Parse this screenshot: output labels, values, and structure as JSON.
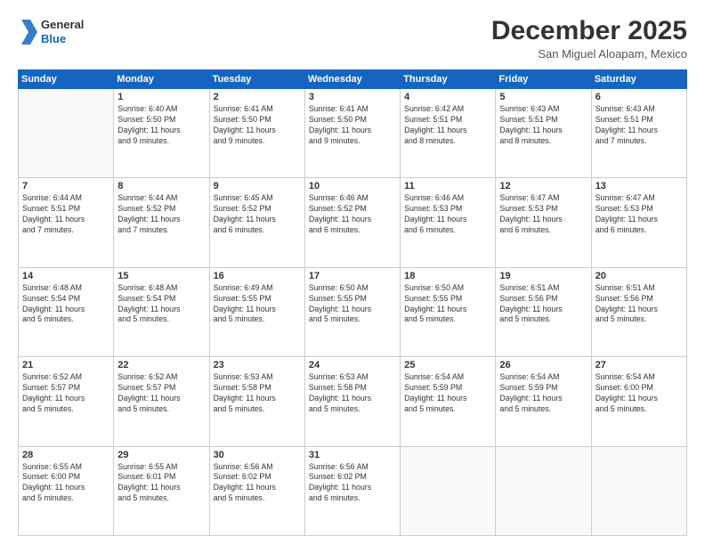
{
  "logo": {
    "line1": "General",
    "line2": "Blue"
  },
  "title": "December 2025",
  "subtitle": "San Miguel Aloapam, Mexico",
  "days_header": [
    "Sunday",
    "Monday",
    "Tuesday",
    "Wednesday",
    "Thursday",
    "Friday",
    "Saturday"
  ],
  "weeks": [
    [
      {
        "num": "",
        "info": ""
      },
      {
        "num": "1",
        "info": "Sunrise: 6:40 AM\nSunset: 5:50 PM\nDaylight: 11 hours\nand 9 minutes."
      },
      {
        "num": "2",
        "info": "Sunrise: 6:41 AM\nSunset: 5:50 PM\nDaylight: 11 hours\nand 9 minutes."
      },
      {
        "num": "3",
        "info": "Sunrise: 6:41 AM\nSunset: 5:50 PM\nDaylight: 11 hours\nand 9 minutes."
      },
      {
        "num": "4",
        "info": "Sunrise: 6:42 AM\nSunset: 5:51 PM\nDaylight: 11 hours\nand 8 minutes."
      },
      {
        "num": "5",
        "info": "Sunrise: 6:43 AM\nSunset: 5:51 PM\nDaylight: 11 hours\nand 8 minutes."
      },
      {
        "num": "6",
        "info": "Sunrise: 6:43 AM\nSunset: 5:51 PM\nDaylight: 11 hours\nand 7 minutes."
      }
    ],
    [
      {
        "num": "7",
        "info": "Sunrise: 6:44 AM\nSunset: 5:51 PM\nDaylight: 11 hours\nand 7 minutes."
      },
      {
        "num": "8",
        "info": "Sunrise: 6:44 AM\nSunset: 5:52 PM\nDaylight: 11 hours\nand 7 minutes."
      },
      {
        "num": "9",
        "info": "Sunrise: 6:45 AM\nSunset: 5:52 PM\nDaylight: 11 hours\nand 6 minutes."
      },
      {
        "num": "10",
        "info": "Sunrise: 6:46 AM\nSunset: 5:52 PM\nDaylight: 11 hours\nand 6 minutes."
      },
      {
        "num": "11",
        "info": "Sunrise: 6:46 AM\nSunset: 5:53 PM\nDaylight: 11 hours\nand 6 minutes."
      },
      {
        "num": "12",
        "info": "Sunrise: 6:47 AM\nSunset: 5:53 PM\nDaylight: 11 hours\nand 6 minutes."
      },
      {
        "num": "13",
        "info": "Sunrise: 6:47 AM\nSunset: 5:53 PM\nDaylight: 11 hours\nand 6 minutes."
      }
    ],
    [
      {
        "num": "14",
        "info": "Sunrise: 6:48 AM\nSunset: 5:54 PM\nDaylight: 11 hours\nand 5 minutes."
      },
      {
        "num": "15",
        "info": "Sunrise: 6:48 AM\nSunset: 5:54 PM\nDaylight: 11 hours\nand 5 minutes."
      },
      {
        "num": "16",
        "info": "Sunrise: 6:49 AM\nSunset: 5:55 PM\nDaylight: 11 hours\nand 5 minutes."
      },
      {
        "num": "17",
        "info": "Sunrise: 6:50 AM\nSunset: 5:55 PM\nDaylight: 11 hours\nand 5 minutes."
      },
      {
        "num": "18",
        "info": "Sunrise: 6:50 AM\nSunset: 5:55 PM\nDaylight: 11 hours\nand 5 minutes."
      },
      {
        "num": "19",
        "info": "Sunrise: 6:51 AM\nSunset: 5:56 PM\nDaylight: 11 hours\nand 5 minutes."
      },
      {
        "num": "20",
        "info": "Sunrise: 6:51 AM\nSunset: 5:56 PM\nDaylight: 11 hours\nand 5 minutes."
      }
    ],
    [
      {
        "num": "21",
        "info": "Sunrise: 6:52 AM\nSunset: 5:57 PM\nDaylight: 11 hours\nand 5 minutes."
      },
      {
        "num": "22",
        "info": "Sunrise: 6:52 AM\nSunset: 5:57 PM\nDaylight: 11 hours\nand 5 minutes."
      },
      {
        "num": "23",
        "info": "Sunrise: 6:53 AM\nSunset: 5:58 PM\nDaylight: 11 hours\nand 5 minutes."
      },
      {
        "num": "24",
        "info": "Sunrise: 6:53 AM\nSunset: 5:58 PM\nDaylight: 11 hours\nand 5 minutes."
      },
      {
        "num": "25",
        "info": "Sunrise: 6:54 AM\nSunset: 5:59 PM\nDaylight: 11 hours\nand 5 minutes."
      },
      {
        "num": "26",
        "info": "Sunrise: 6:54 AM\nSunset: 5:59 PM\nDaylight: 11 hours\nand 5 minutes."
      },
      {
        "num": "27",
        "info": "Sunrise: 6:54 AM\nSunset: 6:00 PM\nDaylight: 11 hours\nand 5 minutes."
      }
    ],
    [
      {
        "num": "28",
        "info": "Sunrise: 6:55 AM\nSunset: 6:00 PM\nDaylight: 11 hours\nand 5 minutes."
      },
      {
        "num": "29",
        "info": "Sunrise: 6:55 AM\nSunset: 6:01 PM\nDaylight: 11 hours\nand 5 minutes."
      },
      {
        "num": "30",
        "info": "Sunrise: 6:56 AM\nSunset: 6:02 PM\nDaylight: 11 hours\nand 5 minutes."
      },
      {
        "num": "31",
        "info": "Sunrise: 6:56 AM\nSunset: 6:02 PM\nDaylight: 11 hours\nand 6 minutes."
      },
      {
        "num": "",
        "info": ""
      },
      {
        "num": "",
        "info": ""
      },
      {
        "num": "",
        "info": ""
      }
    ]
  ]
}
